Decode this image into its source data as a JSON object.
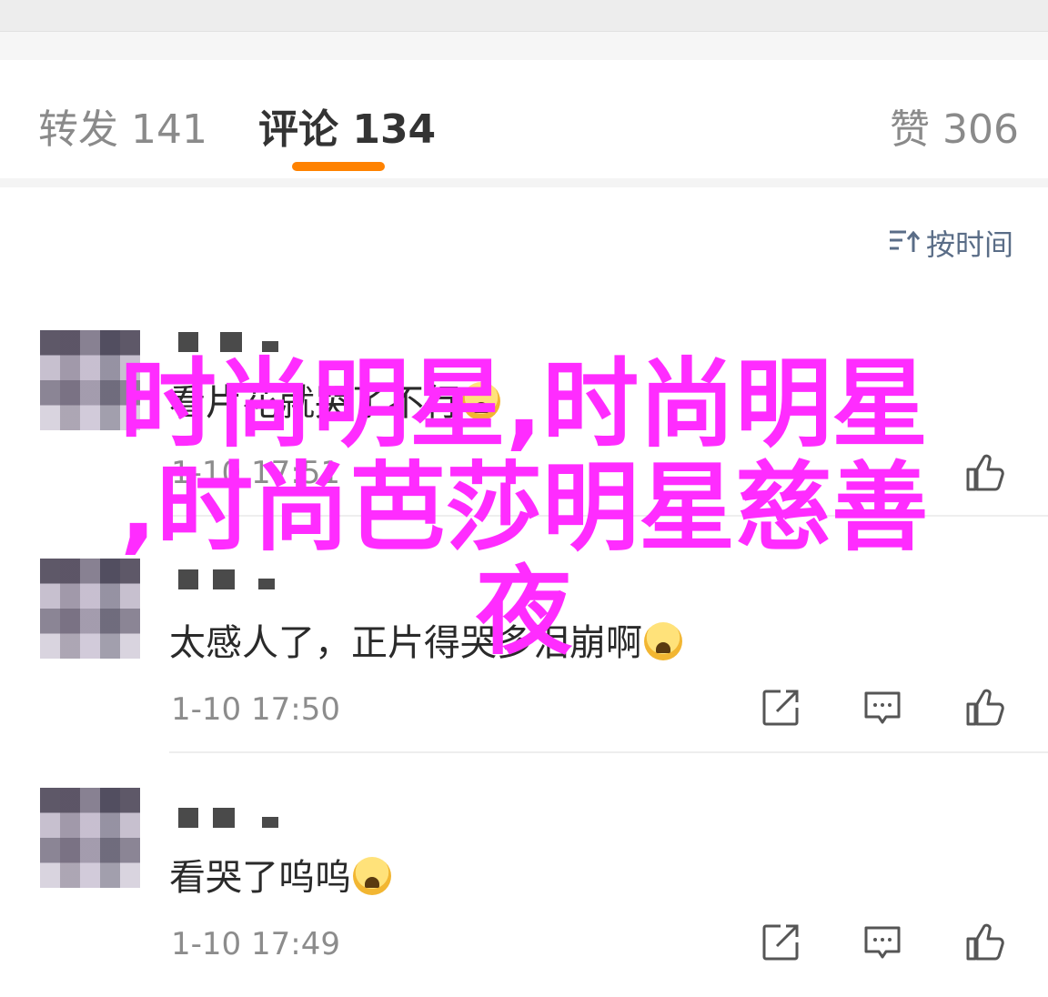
{
  "tabs": [
    {
      "label": "转发",
      "count": "141"
    },
    {
      "label": "评论",
      "count": "134"
    },
    {
      "label": "赞",
      "count": "306"
    }
  ],
  "sort": {
    "icon": "sort-icon",
    "label": "按时间"
  },
  "overlay": {
    "line1": "时尚明星,时尚明星",
    "line2": ",时尚芭莎明星慈善",
    "line3": "夜"
  },
  "comments": [
    {
      "text": "看片花就哭了不行",
      "time": "1-10 17:51"
    },
    {
      "text": "太感人了，正片得哭多泪崩啊",
      "time": "1-10 17:50"
    },
    {
      "text": "看哭了呜呜",
      "time": "1-10 17:49"
    }
  ],
  "icons": {
    "repost": "repost-icon",
    "comment": "comment-icon",
    "like": "thumbs-up-icon"
  },
  "colors": {
    "accent": "#ff8200",
    "overlay": "#ff2cff",
    "link": "#5a6d87"
  }
}
